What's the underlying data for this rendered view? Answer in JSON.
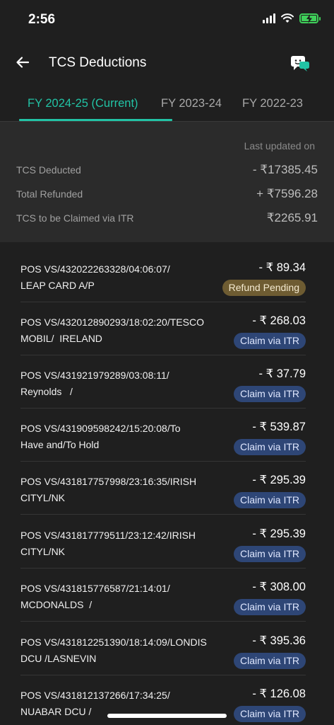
{
  "status_bar": {
    "time": "2:56"
  },
  "header": {
    "title": "TCS Deductions",
    "back_icon": "arrow-left-icon",
    "chat_icon": "chat-bubble-icon"
  },
  "tabs": [
    {
      "label": "FY 2024-25 (Current)",
      "active": true
    },
    {
      "label": "FY 2023-24",
      "active": false
    },
    {
      "label": "FY 2022-23",
      "active": false
    }
  ],
  "summary": {
    "last_updated": "Last updated on",
    "rows": [
      {
        "label": "TCS Deducted",
        "value": "- ₹17385.45"
      },
      {
        "label": "Total Refunded",
        "value": "+ ₹7596.28"
      },
      {
        "label": "TCS to be Claimed via ITR",
        "value": "₹2265.91"
      }
    ]
  },
  "transactions": [
    {
      "desc": "POS VS/432022263328/04:06:07/\nLEAP CARD A/P",
      "amount": "- ₹ 89.34",
      "status": "Refund Pending"
    },
    {
      "desc": "POS VS/432012890293/18:02:20/TESCO\nMOBIL/  IRELAND",
      "amount": "- ₹ 268.03",
      "status": "Claim via ITR"
    },
    {
      "desc": "POS VS/431921979289/03:08:11/\nReynolds   /",
      "amount": "- ₹ 37.79",
      "status": "Claim via ITR"
    },
    {
      "desc": "POS VS/431909598242/15:20:08/To\nHave and/To Hold",
      "amount": "- ₹ 539.87",
      "status": "Claim via ITR"
    },
    {
      "desc": "POS VS/431817757998/23:16:35/IRISH\nCITYL/NK",
      "amount": "- ₹ 295.39",
      "status": "Claim via ITR"
    },
    {
      "desc": "POS VS/431817779511/23:12:42/IRISH\nCITYL/NK",
      "amount": "- ₹ 295.39",
      "status": "Claim via ITR"
    },
    {
      "desc": "POS VS/431815776587/21:14:01/\nMCDONALDS  /",
      "amount": "- ₹ 308.00",
      "status": "Claim via ITR"
    },
    {
      "desc": "POS VS/431812251390/18:14:09/LONDIS\nDCU /LASNEVIN",
      "amount": "- ₹ 395.36",
      "status": "Claim via ITR"
    },
    {
      "desc": "POS VS/431812137266/17:34:25/\nNUABAR DCU /",
      "amount": "- ₹ 126.08",
      "status": "Claim via ITR"
    }
  ],
  "colors": {
    "accent": "#22c3a5",
    "itr_badge": "#2e4676",
    "pending_badge": "#6e5c32",
    "battery": "#3fd05a"
  }
}
